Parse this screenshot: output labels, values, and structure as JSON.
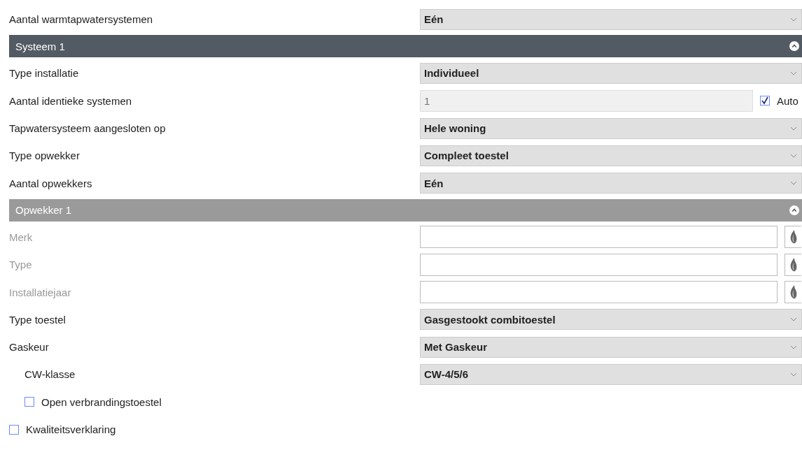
{
  "rows": [
    {
      "kind": "select",
      "label": "Aantal warmtapwatersystemen",
      "disabled": false,
      "value": "Eén"
    },
    {
      "kind": "section",
      "title": "Systeem 1",
      "expanded": true
    },
    {
      "kind": "select",
      "label": "Type installatie",
      "disabled": false,
      "value": "Individueel"
    },
    {
      "kind": "number",
      "label": "Aantal identieke systemen",
      "disabled": false,
      "value": "1",
      "auto": {
        "label": "Auto",
        "checked": true
      }
    },
    {
      "kind": "select",
      "label": "Tapwatersysteem aangesloten op",
      "disabled": false,
      "value": "Hele woning"
    },
    {
      "kind": "select",
      "label": "Type opwekker",
      "disabled": false,
      "value": "Compleet toestel"
    },
    {
      "kind": "select",
      "label": "Aantal opwekkers",
      "disabled": false,
      "value": "Eén"
    },
    {
      "kind": "subsection",
      "title": "Opwekker 1",
      "expanded": true
    },
    {
      "kind": "text",
      "label": "Merk",
      "disabled": true
    },
    {
      "kind": "text",
      "label": "Type",
      "disabled": true
    },
    {
      "kind": "text",
      "label": "Installatiejaar",
      "disabled": true
    },
    {
      "kind": "select",
      "label": "Type toestel",
      "disabled": false,
      "value": "Gasgestookt combitoestel"
    },
    {
      "kind": "select",
      "label": "Gaskeur",
      "disabled": false,
      "value": "Met Gaskeur",
      "children": [
        {
          "kind": "select",
          "label": "CW-klasse",
          "disabled": false,
          "value": "CW-4/5/6"
        },
        {
          "kind": "checkbox",
          "label": "Open verbrandingstoestel",
          "checked": false
        }
      ]
    },
    {
      "kind": "checkbox",
      "label": "Kwaliteitsverklaring",
      "checked": false
    }
  ]
}
